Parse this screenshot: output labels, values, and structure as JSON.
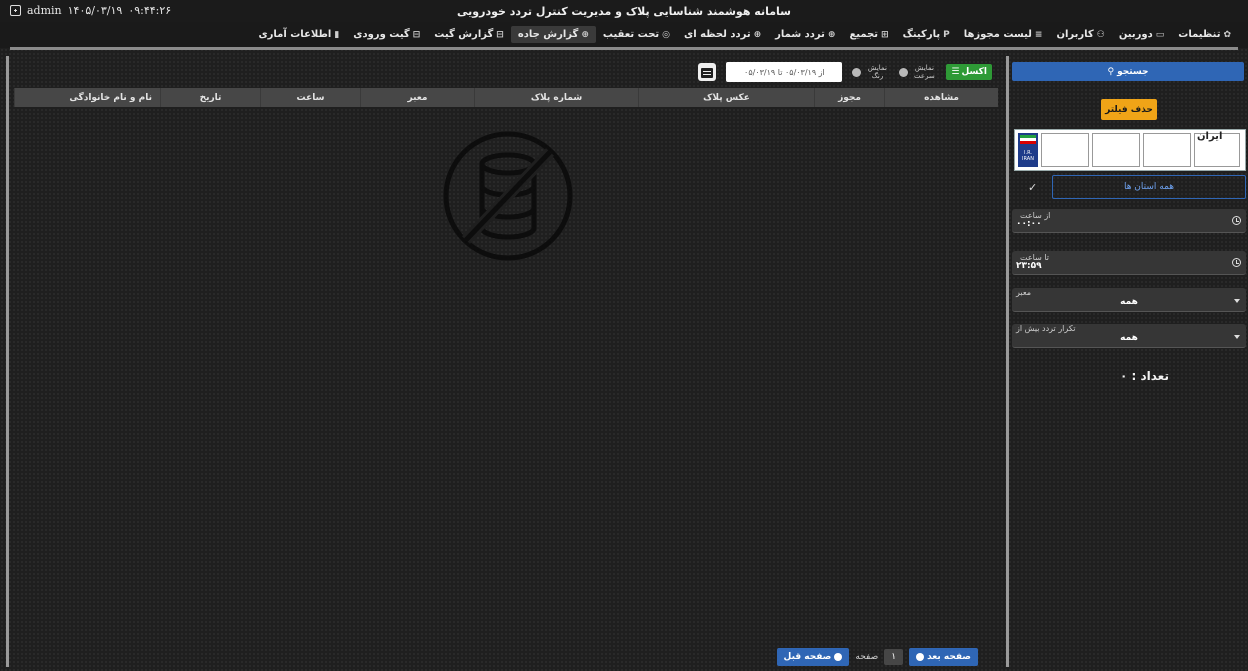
{
  "header": {
    "user": "admin",
    "date": "۱۴۰۵/۰۳/۱۹",
    "time": "۰۹:۴۴:۲۶",
    "title": "سامانه هوشمند شناسایی پلاک و مدیریت کنترل تردد خودرویی"
  },
  "menu": {
    "items": [
      {
        "label": "اطلاعات آماری",
        "icon": "bar-chart-icon"
      },
      {
        "label": "گیت ورودی",
        "icon": "gate-icon"
      },
      {
        "label": "گزارش گیت",
        "icon": "report-icon"
      },
      {
        "label": "گزارش جاده",
        "icon": "road-report-icon"
      },
      {
        "label": "تحت تعقیب",
        "icon": "target-icon"
      },
      {
        "label": "تردد لحظه ای",
        "icon": "plus-circle-icon"
      },
      {
        "label": "تردد شمار",
        "icon": "counter-icon"
      },
      {
        "label": "تجمیع",
        "icon": "grid-icon"
      },
      {
        "label": "پارکینگ",
        "icon": "parking-icon"
      },
      {
        "label": "لیست مجوزها",
        "icon": "list-icon"
      },
      {
        "label": "کاربران",
        "icon": "users-icon"
      },
      {
        "label": "دوربین",
        "icon": "camera-icon"
      },
      {
        "label": "تنظیمات",
        "icon": "gear-icon"
      }
    ]
  },
  "toolbar": {
    "date_range": "از ۰۵/۰۳/۱۹ تا ۰۵/۰۳/۱۹",
    "show_color_label": "نمایش رنگ",
    "show_speed_label": "نمایش سرعت",
    "excel_label": "اکسل"
  },
  "table": {
    "columns": [
      "نام و نام خانوادگی",
      "تاریخ",
      "ساعت",
      "معبر",
      "شماره پلاک",
      "عکس پلاک",
      "مجوز",
      "مشاهده"
    ]
  },
  "pagination": {
    "prev_label": "صفحه قبل",
    "page_label": "صفحه",
    "page_number": "۱",
    "next_label": "صفحه بعد"
  },
  "sidebar": {
    "search_label": "جستجو",
    "remove_filter_label": "حذف فیلتر",
    "plate_country": "ایران",
    "plate_flag_text": "I.R. IRAN",
    "province_label": "همه استان ها",
    "from_time_label": "از ساعت",
    "from_time_value": "۰۰:۰۰",
    "to_time_label": "تا ساعت",
    "to_time_value": "۲۳:۵۹",
    "route_label": "معبر",
    "route_value": "همه",
    "repeat_label": "تکرار تردد بیش از",
    "repeat_value": "همه",
    "count_label": "تعداد : ۰"
  },
  "colors": {
    "accent_blue": "#2f66b5",
    "filter_orange": "#f0a417",
    "excel_green": "#2e9a36"
  }
}
